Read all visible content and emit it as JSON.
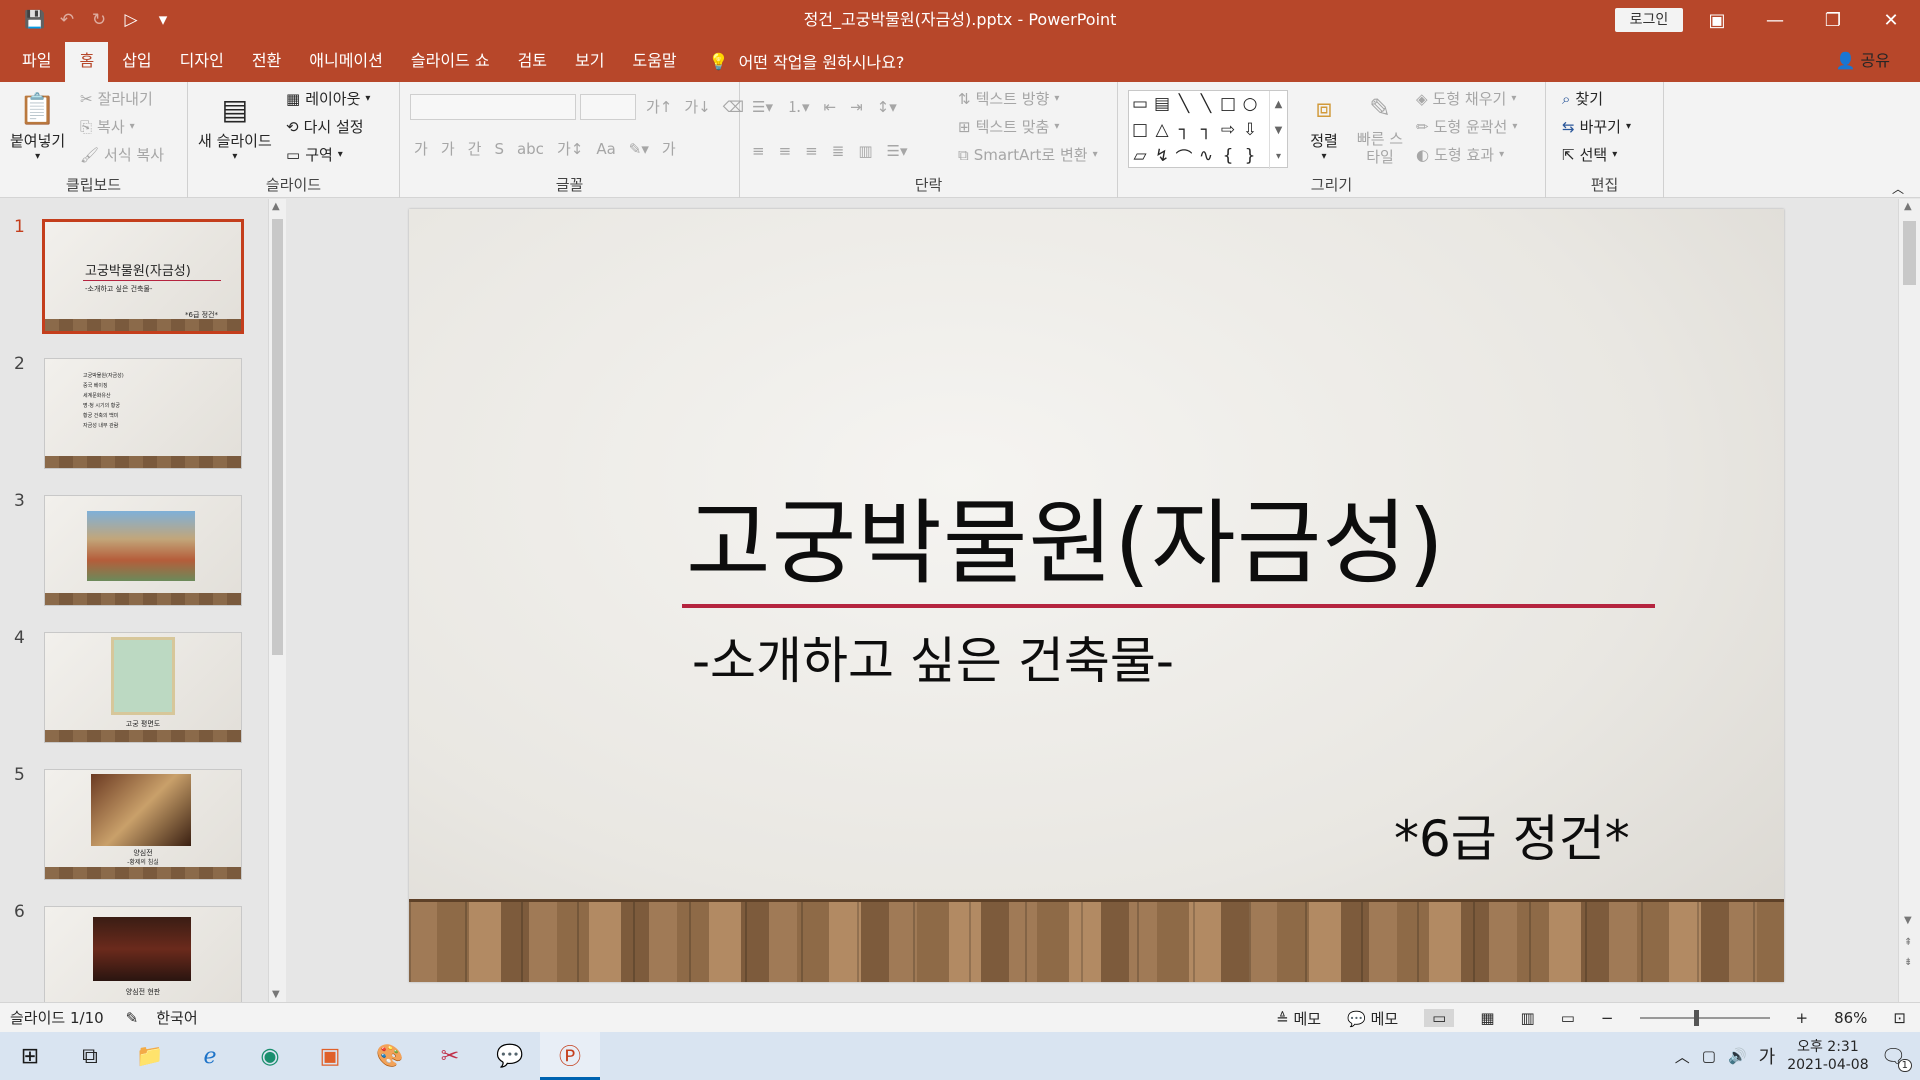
{
  "window": {
    "title": "정건_고궁박물원(자금성).pptx  -  PowerPoint",
    "login_label": "로그인",
    "qat": {
      "save": "💾",
      "undo": "↶",
      "redo": "↻",
      "present": "▷",
      "more": "▾"
    }
  },
  "tabs": [
    "파일",
    "홈",
    "삽입",
    "디자인",
    "전환",
    "애니메이션",
    "슬라이드 쇼",
    "검토",
    "보기",
    "도움말"
  ],
  "active_tab": "홈",
  "tell_me": "어떤 작업을 원하시나요?",
  "share_label": "공유",
  "ribbon": {
    "clipboard": {
      "label": "클립보드",
      "paste": "붙여넣기",
      "cut": "잘라내기",
      "copy": "복사",
      "format_painter": "서식 복사"
    },
    "slides": {
      "label": "슬라이드",
      "new_slide": "새 슬라이드",
      "layout": "레이아웃",
      "reset": "다시 설정",
      "section": "구역"
    },
    "font": {
      "label": "글꼴",
      "row2": [
        "가",
        "가",
        "간",
        "S",
        "abc",
        "가↕",
        "Aa"
      ],
      "row2_color": "가"
    },
    "paragraph": {
      "label": "단락",
      "text_direction": "텍스트 방향",
      "align_text": "텍스트 맞춤",
      "smartart": "SmartArt로 변환"
    },
    "drawing": {
      "label": "그리기",
      "arrange": "정렬",
      "quick_styles": "빠른 스타일",
      "fill": "도형 채우기",
      "outline": "도형 윤곽선",
      "effects": "도형 효과",
      "shape_glyphs": [
        "▭",
        "▤",
        "╲",
        "╲",
        "□",
        "○",
        "",
        "□",
        "△",
        "┐",
        "┐",
        "⇨",
        "⇩",
        "",
        "▱",
        "↯",
        "⌒",
        "∿",
        "{",
        "}",
        ""
      ]
    },
    "editing": {
      "label": "편집",
      "find": "찾기",
      "replace": "바꾸기",
      "select": "선택"
    }
  },
  "thumbnails": [
    {
      "num": "1",
      "title": "고궁박물원(자금성)",
      "sub": "-소개하고 싶은 건축물-",
      "author": "*6급 정건*"
    },
    {
      "num": "2",
      "lines": [
        "고궁박물원(자금성)",
        "중국 베이징",
        "세계문화유산",
        "명·청 시기의 황궁",
        "황궁 건축의 백미",
        "자금성 내부 관람"
      ]
    },
    {
      "num": "3"
    },
    {
      "num": "4",
      "caption": "고궁 평면도"
    },
    {
      "num": "5",
      "caption": "양심전",
      "caption2": "-황제의 침실"
    },
    {
      "num": "6",
      "caption": "양심전 현판"
    }
  ],
  "slide": {
    "title": "고궁박물원(자금성)",
    "subtitle": "-소개하고 싶은 건축물-",
    "author": "*6급  정건*"
  },
  "status": {
    "slide_count": "슬라이드 1/10",
    "language": "한국어",
    "notes": "메모",
    "comments": "메모",
    "zoom": "86%"
  },
  "taskbar": {
    "time": "오후 2:31",
    "date": "2021-04-08",
    "ime": "가",
    "notification_count": "1"
  },
  "colors": {
    "accent": "#b7472a",
    "title_underline": "#b5243f",
    "selected_thumb": "#c43e1c"
  }
}
